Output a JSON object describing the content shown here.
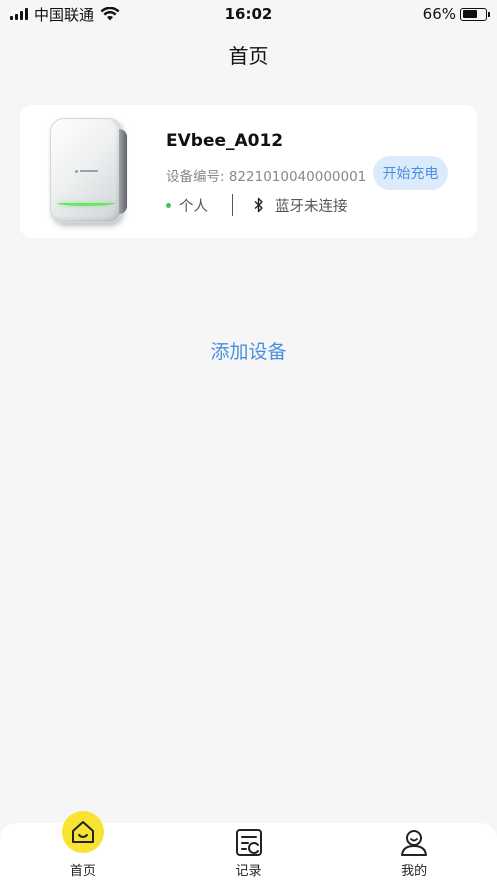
{
  "status_bar": {
    "carrier": "中国联通",
    "time": "16:02",
    "battery_percent": "66%",
    "battery_level": 0.66
  },
  "nav": {
    "title": "首页"
  },
  "device": {
    "name": "EVbee_A012",
    "serial": "设备编号: 8221010040000001",
    "start_label": "开始充电",
    "owner_type": "个人",
    "bluetooth_status": "蓝牙未连接",
    "status_color": "#4cc05a"
  },
  "add_device_label": "添加设备",
  "accent_color": "#4a90e2",
  "tabs": [
    {
      "label": "首页",
      "icon": "home-icon",
      "active": true
    },
    {
      "label": "记录",
      "icon": "records-icon",
      "active": false
    },
    {
      "label": "我的",
      "icon": "profile-icon",
      "active": false
    }
  ]
}
